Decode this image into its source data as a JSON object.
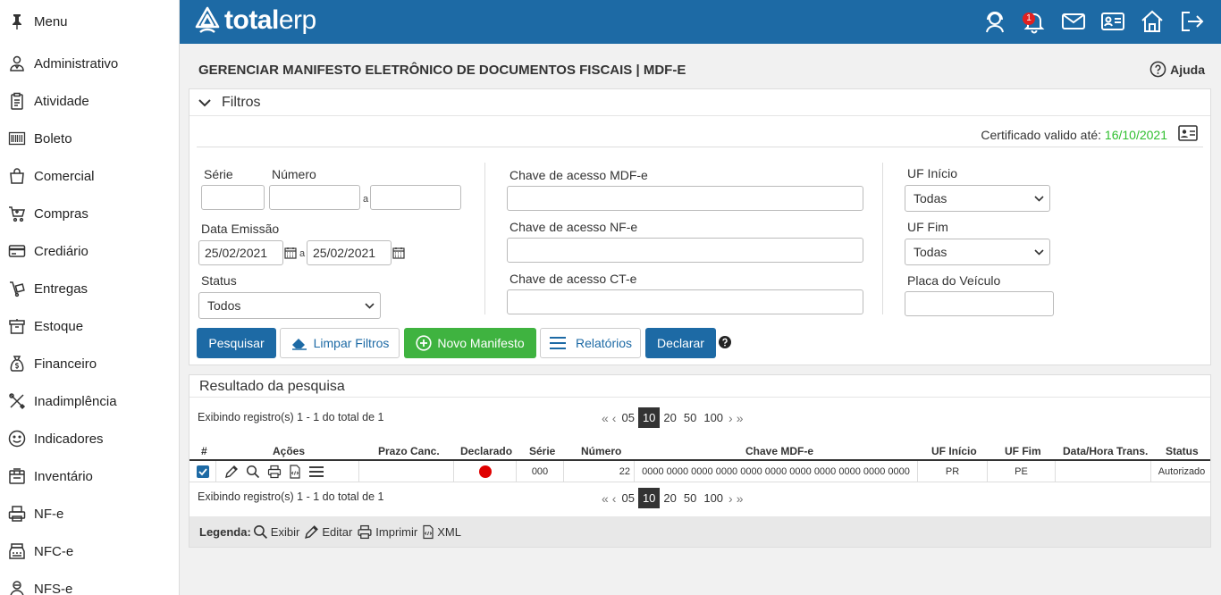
{
  "sidebar": {
    "items": [
      {
        "label": "Menu",
        "icon": "pin-icon"
      },
      {
        "label": "Administrativo",
        "icon": "users-icon"
      },
      {
        "label": "Atividade",
        "icon": "clipboard-icon"
      },
      {
        "label": "Boleto",
        "icon": "barcode-icon"
      },
      {
        "label": "Comercial",
        "icon": "shopping-bag-icon"
      },
      {
        "label": "Compras",
        "icon": "cart-icon"
      },
      {
        "label": "Crediário",
        "icon": "credit-card-icon"
      },
      {
        "label": "Entregas",
        "icon": "delivery-icon"
      },
      {
        "label": "Estoque",
        "icon": "box-icon"
      },
      {
        "label": "Financeiro",
        "icon": "money-bag-icon"
      },
      {
        "label": "Inadimplência",
        "icon": "tools-icon"
      },
      {
        "label": "Indicadores",
        "icon": "smile-icon"
      },
      {
        "label": "Inventário",
        "icon": "inventory-icon"
      },
      {
        "label": "NF-e",
        "icon": "printer-icon"
      },
      {
        "label": "NFC-e",
        "icon": "cash-register-icon"
      },
      {
        "label": "NFS-e",
        "icon": "person-icon"
      }
    ]
  },
  "header": {
    "logo_bold": "total",
    "logo_light": "erp",
    "notification_count": "1"
  },
  "page": {
    "title": "GERENCIAR MANIFESTO ELETRÔNICO DE DOCUMENTOS FISCAIS | MDF-E",
    "help_label": "Ajuda"
  },
  "filters": {
    "title": "Filtros",
    "cert_label": "Certificado valido até: ",
    "cert_date": "16/10/2021",
    "serie_label": "Série",
    "numero_label": "Número",
    "range_sep": "a",
    "data_emissao_label": "Data Emissão",
    "data_inicio": "25/02/2021",
    "data_fim": "25/02/2021",
    "status_label": "Status",
    "status_value": "Todos",
    "chave_mdfe_label": "Chave de acesso MDF-e",
    "chave_nfe_label": "Chave de acesso NF-e",
    "chave_cte_label": "Chave de acesso CT-e",
    "uf_inicio_label": "UF Início",
    "uf_inicio_value": "Todas",
    "uf_fim_label": "UF Fim",
    "uf_fim_value": "Todas",
    "placa_label": "Placa do Veículo"
  },
  "buttons": {
    "pesquisar": "Pesquisar",
    "limpar": "Limpar Filtros",
    "novo": "Novo Manifesto",
    "relatorios": "Relatórios",
    "declarar": "Declarar"
  },
  "results": {
    "title": "Resultado da pesquisa",
    "records_text": "Exibindo registro(s) 1 - 1 do total de 1",
    "page_sizes": [
      "05",
      "10",
      "20",
      "50",
      "100"
    ],
    "active_page_size": "10",
    "columns": [
      "#",
      "Ações",
      "Prazo Canc.",
      "Declarado",
      "Série",
      "Número",
      "Chave MDF-e",
      "UF Início",
      "UF Fim",
      "Data/Hora Trans.",
      "Status"
    ],
    "rows": [
      {
        "prazo": "",
        "declarado_color": "#e00000",
        "serie": "000",
        "numero": "22",
        "chave": "0000 0000 0000 0000 0000 0000 0000 0000 0000 0000 0000",
        "uf_inicio": "PR",
        "uf_fim": "PE",
        "data_hora": "",
        "status": "Autorizado"
      }
    ]
  },
  "legend": {
    "label": "Legenda:",
    "exibir": "Exibir",
    "editar": "Editar",
    "imprimir": "Imprimir",
    "xml": "XML"
  },
  "colors": {
    "primary": "#1d6aa5",
    "success": "#3fb340",
    "cert_date": "#2fbf2f"
  }
}
